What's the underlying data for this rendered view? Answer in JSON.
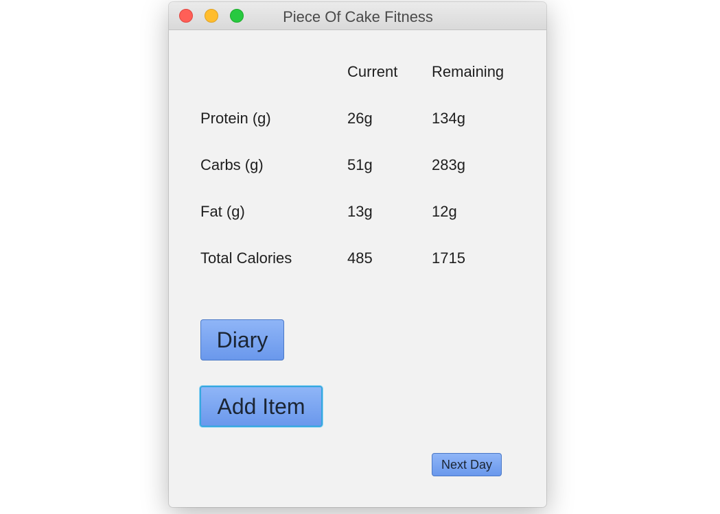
{
  "window": {
    "title": "Piece Of Cake Fitness"
  },
  "table": {
    "headers": [
      "Current",
      "Remaining"
    ],
    "rows": [
      {
        "label": "Protein (g)",
        "current": "26g",
        "remaining": "134g"
      },
      {
        "label": "Carbs (g)",
        "current": "51g",
        "remaining": "283g"
      },
      {
        "label": "Fat (g)",
        "current": "13g",
        "remaining": "12g"
      },
      {
        "label": "Total Calories",
        "current": "485",
        "remaining": "1715"
      }
    ]
  },
  "buttons": {
    "diary": "Diary",
    "add_item": "Add Item",
    "next_day": "Next Day"
  },
  "colors": {
    "button_fill": "#7aa6f2",
    "focus_ring": "#36a7df",
    "window_bg": "#f2f2f2"
  }
}
